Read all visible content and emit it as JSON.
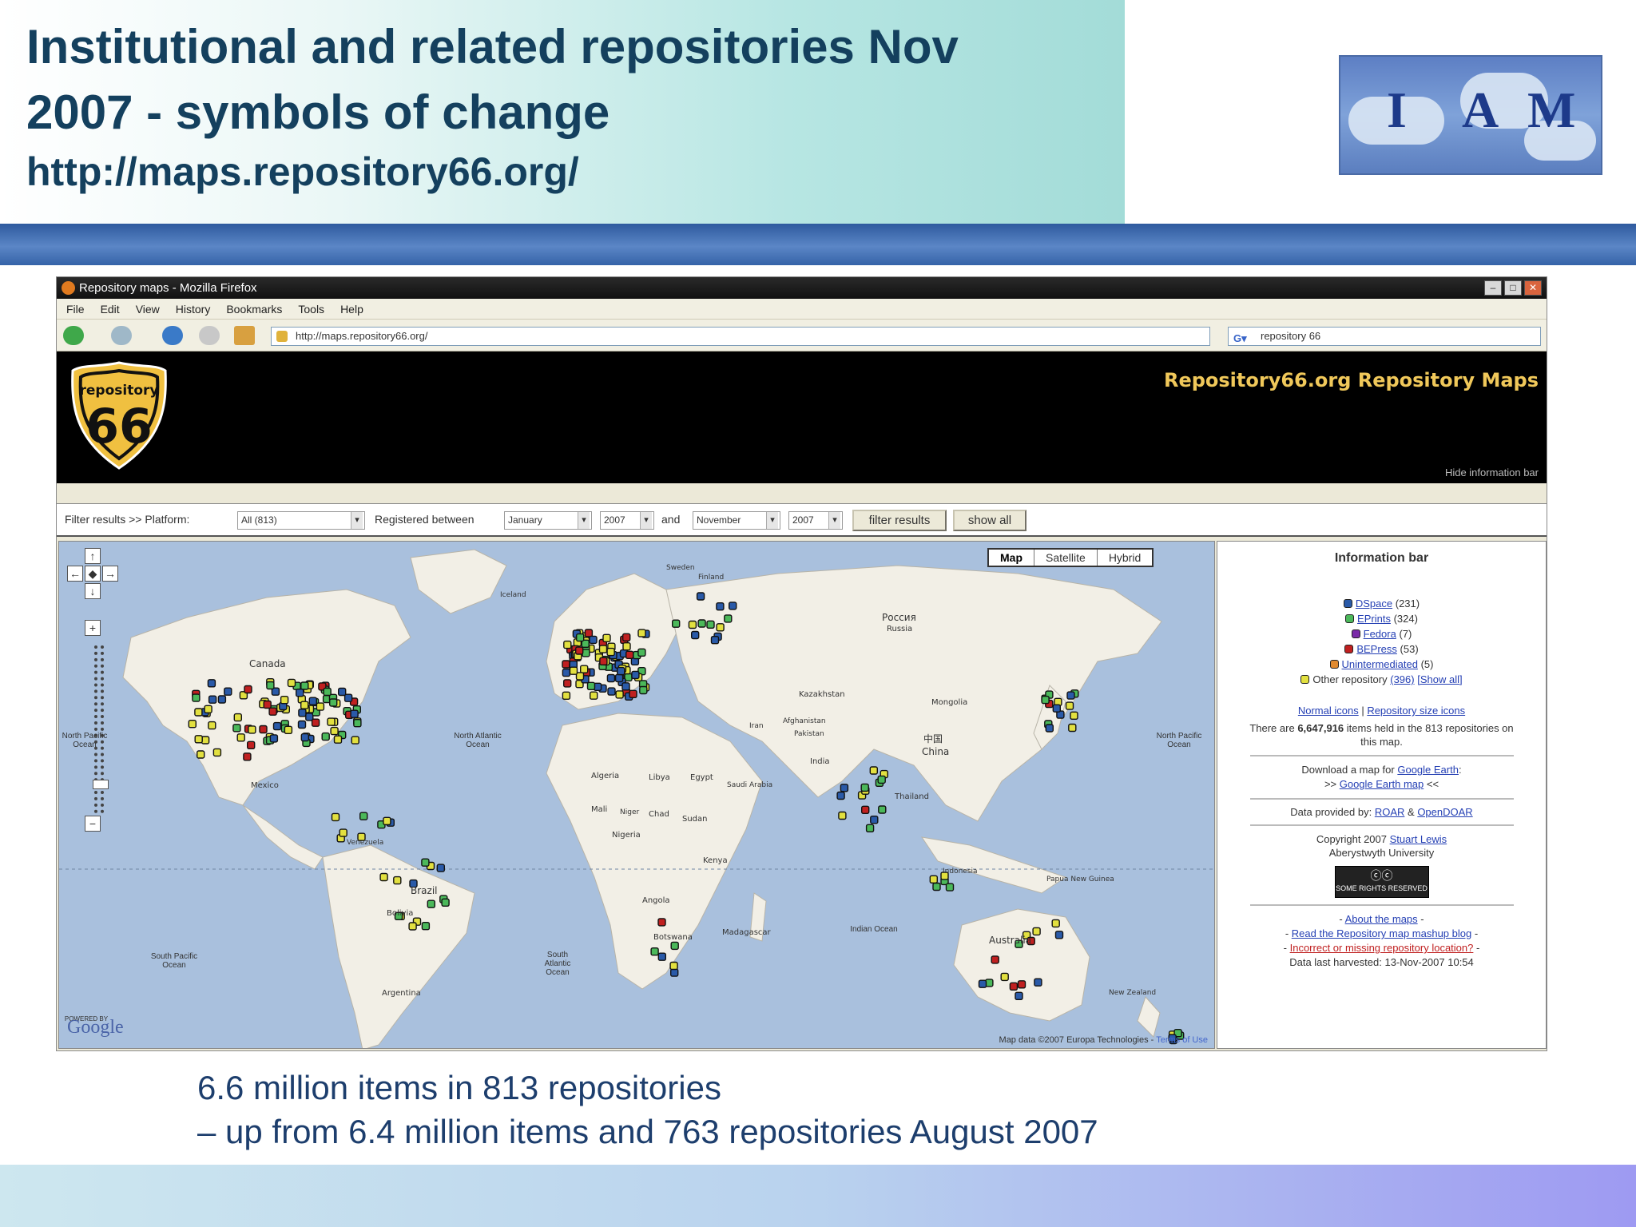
{
  "slide": {
    "title_line1": "Institutional and related repositories Nov",
    "title_line2": "2007 - symbols of change",
    "url": "http://maps.repository66.org/",
    "caption_line1": "6.6 million items in 813 repositories",
    "caption_line2": "– up from 6.4 million items and 763 repositories August 2007",
    "logo": {
      "letters": [
        "I",
        "A",
        "M"
      ]
    }
  },
  "browser": {
    "window_title": "Repository maps - Mozilla Firefox",
    "menu": [
      "File",
      "Edit",
      "View",
      "History",
      "Bookmarks",
      "Tools",
      "Help"
    ],
    "address": "http://maps.repository66.org/",
    "search_value": "repository 66"
  },
  "site": {
    "logo_top": "repository",
    "logo_number": "66",
    "title": "Repository66.org Repository Maps",
    "hide_link": "Hide information bar"
  },
  "filter": {
    "prefix": "Filter results >> Platform:",
    "platform_value": "All (813)",
    "registered_label": "Registered between",
    "from_month": "January",
    "from_year": "2007",
    "and_label": "and",
    "to_month": "November",
    "to_year": "2007",
    "filter_button": "filter results",
    "show_all_button": "show all"
  },
  "map": {
    "type_buttons": [
      "Map",
      "Satellite",
      "Hybrid"
    ],
    "labels": {
      "canada": "Canada",
      "russia": "Россия",
      "russia_latin": "Russia",
      "kazakhstan": "Kazakhstan",
      "mongolia": "Mongolia",
      "china_cn": "中国",
      "china": "China",
      "algeria": "Algeria",
      "libya": "Libya",
      "egypt": "Egypt",
      "saudi": "Saudi Arabia",
      "mali": "Mali",
      "niger": "Niger",
      "chad": "Chad",
      "sudan": "Sudan",
      "nigeria": "Nigeria",
      "kenya": "Kenya",
      "angola": "Angola",
      "botswana": "Botswana",
      "madagascar": "Madagascar",
      "brazil": "Brazil",
      "bolivia": "Bolivia",
      "argentina": "Argentina",
      "australia": "Australia",
      "india": "India",
      "pakistan": "Pakistan",
      "afghanistan": "Afghanistan",
      "iran": "Iran",
      "thailand": "Thailand",
      "indonesia": "Indonesia",
      "png": "Papua New Guinea",
      "nz": "New Zealand",
      "iceland": "Iceland",
      "sweden": "Sweden",
      "finland": "Finland",
      "mexico": "Mexico",
      "venezuela": "Venezuela",
      "ocean_north_atlantic": "North Atlantic Ocean",
      "ocean_north_pacific": "North Pacific Ocean",
      "ocean_north_pacific_left": "North Pacific Ocean",
      "ocean_south_pacific": "South Pacific Ocean",
      "ocean_south_atlantic": "South Atlantic Ocean",
      "ocean_indian": "Indian Ocean"
    },
    "powered_by": "POWERED BY",
    "google": "Google",
    "map_data": "Map data ©2007 Europa Technologies -",
    "terms": "Terms of Use"
  },
  "info": {
    "heading": "Information bar",
    "legend": [
      {
        "name": "DSpace",
        "count": "(231)",
        "color": "#2a5aa8"
      },
      {
        "name": "EPrints",
        "count": "(324)",
        "color": "#4bb85a"
      },
      {
        "name": "Fedora",
        "count": "(7)",
        "color": "#7a2aa8"
      },
      {
        "name": "BEPress",
        "count": "(53)",
        "color": "#c02020"
      },
      {
        "name": "Unintermediated",
        "count": "(5)",
        "color": "#e08a30"
      }
    ],
    "other_label": "Other repository",
    "other_count": "(396)",
    "show_all": "[Show all]",
    "normal_icons": "Normal icons",
    "size_icons": "Repository size icons",
    "items_text_pre": "There are",
    "items_count": "6,647,916",
    "items_text_post": "items held in the 813 repositories on this map.",
    "download_text": "Download a map for",
    "google_earth": "Google Earth",
    "google_earth_map": "Google Earth map",
    "data_provided": "Data provided by:",
    "roar": "ROAR",
    "amp": "&",
    "opendoar": "OpenDOAR",
    "copyright": "Copyright 2007",
    "author": "Stuart Lewis",
    "university": "Aberystwyth University",
    "cc_badge": "SOME RIGHTS RESERVED",
    "about": "About the maps",
    "blog": "Read the Repository map mashup blog",
    "incorrect": "Incorrect or missing repository location?",
    "harvest_label": "Data last harvested:",
    "harvest_date": "13-Nov-2007 10:54"
  }
}
